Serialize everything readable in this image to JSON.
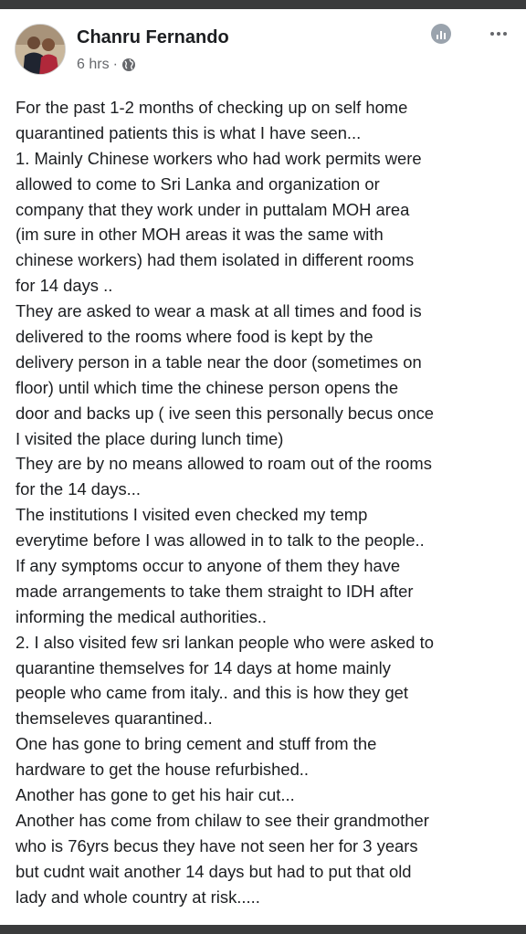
{
  "post": {
    "author": "Chanru Fernando",
    "time": "6 hrs",
    "separator": "·",
    "privacy_icon": "globe-icon",
    "header_icons": [
      "insights-icon",
      "more-icon"
    ],
    "lines": [
      "For the past 1-2 months of checking up on self home",
      "quarantined patients this is what I have seen...",
      "1. Mainly Chinese workers who had work permits were",
      "allowed to come to Sri Lanka and organization or",
      "company that they work under in puttalam MOH area",
      "(im sure in other MOH areas it was the same with",
      "chinese workers) had them isolated in different rooms",
      "for 14 days ..",
      "They are asked to wear a mask at all times and food is",
      "delivered to the rooms where food is kept by the",
      "delivery person in a table near the door (sometimes on",
      "floor) until which time the chinese person opens the",
      "door and backs up ( ive seen this personally becus once",
      "I visited the place during lunch time)",
      "They are by no means allowed to roam out of the rooms",
      "for the 14 days...",
      "The institutions I visited even checked my temp",
      "everytime before I was allowed in to talk to the people..",
      "If any symptoms occur to anyone of them they have",
      "made arrangements to take them straight to IDH after",
      "informing the medical authorities..",
      "2. I also visited few sri lankan people who were asked to",
      "quarantine themselves for 14 days at home mainly",
      "people who came from italy.. and this is how they get",
      "themseleves quarantined..",
      "One has gone to bring cement and stuff from the",
      "hardware to get the house refurbished..",
      "Another has gone to get his hair cut...",
      "Another has come from chilaw to see their grandmother",
      "who is 76yrs becus they have not seen her for 3 years",
      "but cudnt wait another 14 days but had to put that old",
      "lady and whole country at risk....."
    ]
  }
}
